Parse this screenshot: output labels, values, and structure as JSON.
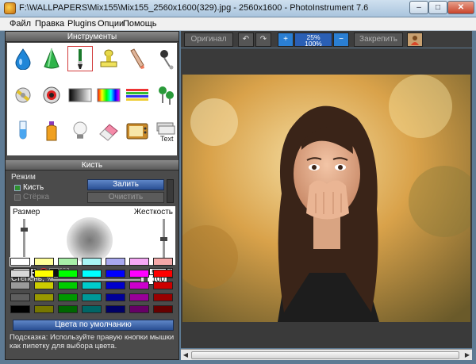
{
  "window": {
    "title": "F:\\WALLPAPERS\\Mix155\\Mix155_2560x1600(329).jpg - 2560x1600 - PhotoInstrument 7.6"
  },
  "menu": [
    "Файл",
    "Правка",
    "Plugins",
    "Опции",
    "Помощь"
  ],
  "tools_panel": {
    "title": "Инструменты",
    "tools": [
      "water-drop-icon",
      "green-cone-icon",
      "brush-icon",
      "stamp-icon",
      "eraser-stick-icon",
      "pin-icon",
      "wrench-icon",
      "eye-icon",
      "gradient-icon",
      "rainbow-icon",
      "lines-icon",
      "pushpin-icon",
      "test-tube-icon",
      "bottle-icon",
      "bulb-icon",
      "eraser-icon",
      "tv-icon",
      "text-stack-icon"
    ],
    "text_tool_label": "Text",
    "selected_index": 2
  },
  "brush_panel": {
    "title": "Кисть",
    "mode_label": "Режим",
    "mode_brush": "Кисть",
    "mode_erase": "Стёрка",
    "fill_button": "Залить",
    "clear_button": "Очистить",
    "size_label": "Размер",
    "hardness_label": "Жесткость",
    "size_value": "75",
    "hardness_value": "50",
    "size_level": 0.75,
    "hardness_level": 0.5,
    "degree_label": "Степень, %",
    "degree_value": "100",
    "default_colors_button": "Цвета по умолчанию",
    "hint": "Подсказка: Используйте правую кнопки мышки как пипетку для выбора цвета."
  },
  "palette": {
    "columns": [
      [
        "#ffffff",
        "#d8d8d8",
        "#9a9a9a",
        "#5e5e5e",
        "#000000"
      ],
      [
        "#ffff99",
        "#ffff00",
        "#cccc00",
        "#999900",
        "#777700"
      ],
      [
        "#a8f0a8",
        "#00ff00",
        "#00cc00",
        "#009900",
        "#006600"
      ],
      [
        "#a8f5f5",
        "#00ffff",
        "#00cccc",
        "#009999",
        "#006666"
      ],
      [
        "#a8a8f0",
        "#0000ff",
        "#0000cc",
        "#000099",
        "#000066"
      ],
      [
        "#f5a8f5",
        "#ff00ff",
        "#cc00cc",
        "#990099",
        "#660066"
      ],
      [
        "#f5a8a8",
        "#ff0000",
        "#cc0000",
        "#990000",
        "#660000"
      ]
    ]
  },
  "toolbar": {
    "original": "Оригинал",
    "zoom_top": "25%",
    "zoom_bottom": "100%",
    "fix": "Закрепить"
  }
}
